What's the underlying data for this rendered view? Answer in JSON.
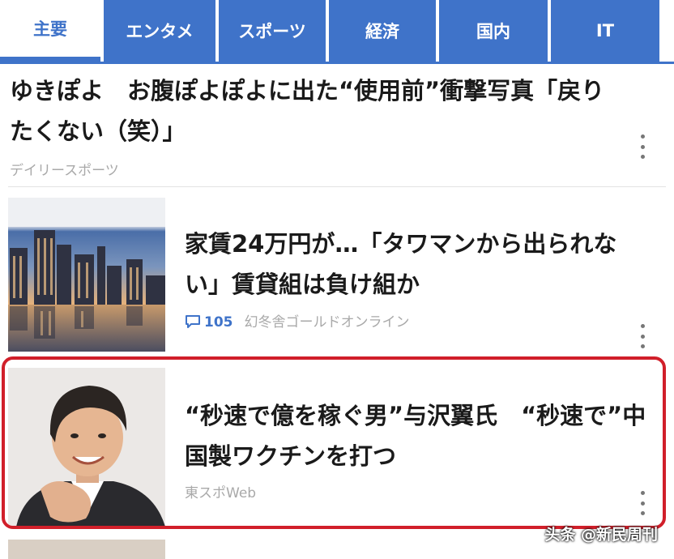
{
  "tabs": [
    {
      "label": "主要",
      "active": true
    },
    {
      "label": "エンタメ",
      "active": false
    },
    {
      "label": "スポーツ",
      "active": false
    },
    {
      "label": "経済",
      "active": false
    },
    {
      "label": "国内",
      "active": false
    },
    {
      "label": "IT",
      "active": false
    }
  ],
  "articles": [
    {
      "title_line1": "ゆきぽよ　お腹ぽよぽよに出た“使用前”衝撃写真「戻り",
      "title_line2": "たくない（笑）」",
      "source": "デイリースポーツ"
    },
    {
      "title_line1": "家賃24万円が…「タワマンから出られな",
      "title_line2": "い」賃貸組は負け組か",
      "comment_count": "105",
      "source": "幻冬舎ゴールドオンライン",
      "thumbnail": "city-skyline-image"
    },
    {
      "title_line1": "“秒速で億を稼ぐ男”与沢翼氏　“秒速で”中",
      "title_line2": "国製ワクチンを打つ",
      "source": "東スポWeb",
      "thumbnail": "person-portrait-image"
    }
  ],
  "watermark": "头条 @新民周刊",
  "colors": {
    "accent": "#3f73c9",
    "highlight": "#d11f2a"
  }
}
